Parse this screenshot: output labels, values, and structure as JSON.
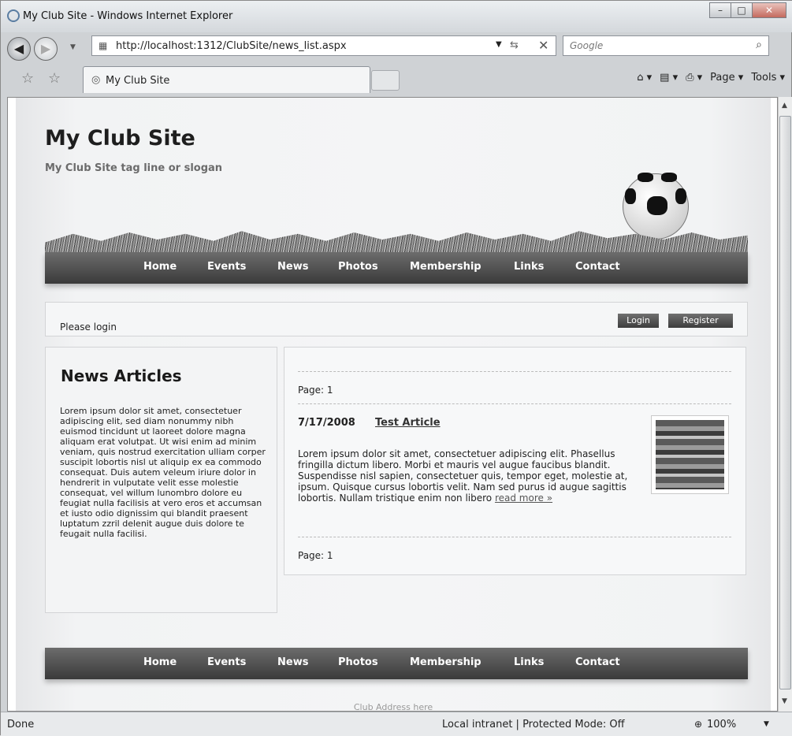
{
  "window": {
    "title": "My Club Site - Windows Internet Explorer"
  },
  "addressbar": {
    "url": "http://localhost:1312/ClubSite/news_list.aspx",
    "search_placeholder": "Google"
  },
  "tab": {
    "label": "My Club Site"
  },
  "toolbar": {
    "page": "Page ▾",
    "tools": "Tools ▾"
  },
  "site": {
    "title": "My Club Site",
    "tagline": "My Club Site tag line or slogan"
  },
  "menu": [
    "Home",
    "Events",
    "News",
    "Photos",
    "Membership",
    "Links",
    "Contact"
  ],
  "login": {
    "message": "Please login",
    "login_button": "Login",
    "register_button": "Register"
  },
  "sidebar": {
    "heading": "News Articles",
    "text": "Lorem ipsum dolor sit amet, consectetuer adipiscing elit, sed diam nonummy nibh euismod tincidunt ut laoreet dolore magna aliquam erat volutpat. Ut wisi enim ad minim veniam, quis nostrud exercitation ulliam corper suscipit lobortis nisl ut aliquip ex ea commodo consequat. Duis autem veleum iriure dolor in hendrerit in vulputate velit esse molestie consequat, vel willum lunombro dolore eu feugiat nulla facilisis at vero eros et accumsan et iusto odio dignissim qui blandit praesent luptatum zzril delenit augue duis dolore te feugait nulla facilisi."
  },
  "articles": {
    "pager_top": "Page:  1",
    "pager_bottom": "Page:  1",
    "date": "7/17/2008",
    "title": "Test Article",
    "body": "Lorem ipsum dolor sit amet, consectetuer adipiscing elit. Phasellus fringilla dictum libero. Morbi et mauris vel augue faucibus blandit. Suspendisse nisl sapien, consectetuer quis, tempor eget, molestie at, ipsum. Quisque cursus lobortis velit. Nam sed purus id augue sagittis lobortis. Nullam tristique enim non libero ",
    "read_more": "read more »"
  },
  "footer": {
    "address": "Club Address here"
  },
  "status": {
    "left": "Done",
    "zone": "Local intranet | Protected Mode: Off",
    "zoom": "100%"
  }
}
